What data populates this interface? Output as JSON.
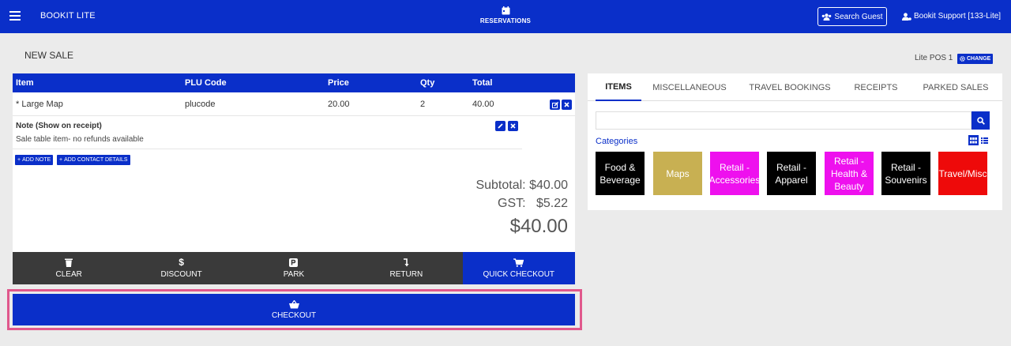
{
  "topbar": {
    "brand": "BOOKIT LITE",
    "nav_reservations": "RESERVATIONS",
    "search_guest": "Search Guest",
    "user": "Bookit Support [133-Lite]"
  },
  "page": {
    "title": "NEW SALE",
    "pos_label": "Lite POS 1",
    "change_label": "CHANGE"
  },
  "table": {
    "headers": [
      "Item",
      "PLU Code",
      "Price",
      "Qty",
      "Total"
    ],
    "rows": [
      {
        "item": "* Large Map",
        "plu": "plucode",
        "price": "20.00",
        "qty": "2",
        "total": "40.00"
      }
    ],
    "note_title": "Note (Show on receipt)",
    "note_text": "Sale table item- no refunds available",
    "add_note": "ADD NOTE",
    "add_contact": "ADD CONTACT DETAILS"
  },
  "totals": {
    "subtotal_label": "Subtotal:",
    "subtotal_value": "$40.00",
    "gst_label": "GST:",
    "gst_value": "$5.22",
    "grand_total": "$40.00"
  },
  "actions": {
    "clear": "CLEAR",
    "discount": "DISCOUNT",
    "park": "PARK",
    "return": "RETURN",
    "quick_checkout": "QUICK CHECKOUT",
    "checkout": "CHECKOUT"
  },
  "right": {
    "tabs": [
      "ITEMS",
      "MISCELLANEOUS",
      "TRAVEL BOOKINGS",
      "RECEIPTS",
      "PARKED SALES"
    ],
    "active_tab": "ITEMS",
    "categories_label": "Categories",
    "tiles": [
      {
        "label": "Food & Beverage",
        "color": "#000000"
      },
      {
        "label": "Maps",
        "color": "#c8b052"
      },
      {
        "label": "Retail - Accessories",
        "color": "#ee10ee"
      },
      {
        "label": "Retail - Apparel",
        "color": "#000000"
      },
      {
        "label": "Retail - Health & Beauty",
        "color": "#ee10ee"
      },
      {
        "label": "Retail - Souvenirs",
        "color": "#000000"
      },
      {
        "label": "Travel/Misc",
        "color": "#ee0a0a"
      }
    ]
  },
  "colors": {
    "primary": "#0a2fc9",
    "dark_action": "#3a3a3a",
    "highlight": "#e0588c"
  }
}
